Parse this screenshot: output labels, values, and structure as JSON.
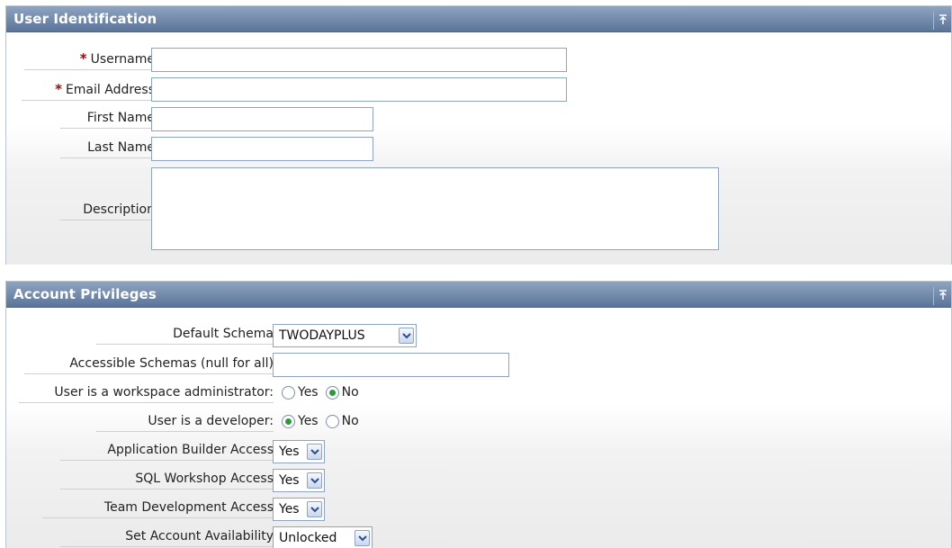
{
  "user_identification": {
    "title": "User Identification",
    "top_label": "↑",
    "fields": {
      "username": {
        "label": "Username",
        "required_mark": "*",
        "value": ""
      },
      "email": {
        "label": "Email Address",
        "required_mark": "*",
        "value": ""
      },
      "first_name": {
        "label": "First Name",
        "value": ""
      },
      "last_name": {
        "label": "Last Name",
        "value": ""
      },
      "description": {
        "label": "Description",
        "value": ""
      }
    }
  },
  "account_privileges": {
    "title": "Account Privileges",
    "top_label": "↑",
    "default_schema": {
      "label": "Default Schema",
      "value": "TWODAYPLUS"
    },
    "accessible_schemas": {
      "label": "Accessible Schemas (null for all)",
      "value": ""
    },
    "workspace_admin": {
      "label": "User is a workspace administrator:",
      "yes": "Yes",
      "no": "No",
      "selected": "No"
    },
    "developer": {
      "label": "User is a developer:",
      "yes": "Yes",
      "no": "No",
      "selected": "Yes"
    },
    "app_builder": {
      "label": "Application Builder Access",
      "value": "Yes"
    },
    "sql_workshop": {
      "label": "SQL Workshop Access",
      "value": "Yes"
    },
    "team_dev": {
      "label": "Team Development Access",
      "value": "Yes"
    },
    "availability": {
      "label": "Set Account Availability",
      "value": "Unlocked"
    }
  },
  "colors": {
    "header_top": "#8ea4c0",
    "header_bottom": "#5b7499",
    "field_border": "#8ea4c0",
    "required": "#b40000",
    "radio_on": "#2a9a3a"
  }
}
